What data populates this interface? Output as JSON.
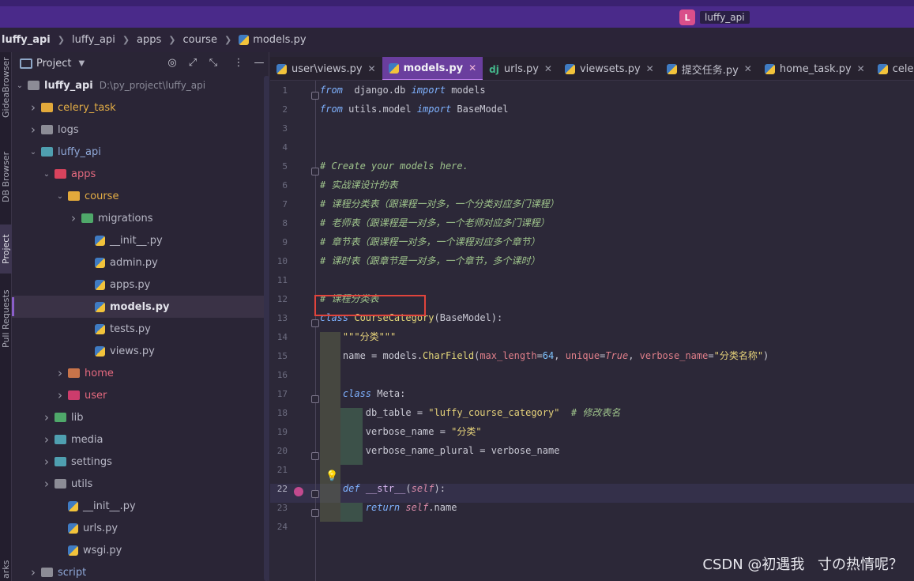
{
  "window": {
    "project_chip_letter": "L",
    "project_chip_name": "luffy_api"
  },
  "breadcrumb": [
    "luffy_api",
    "luffy_api",
    "apps",
    "course",
    "models.py"
  ],
  "toolstrip": {
    "tabs": [
      "GideaBrowser",
      "DB Browser",
      "Project",
      "Pull Requests",
      "arks"
    ]
  },
  "project_panel": {
    "title": "Project",
    "tree": [
      {
        "label": "luffy_api",
        "path": "D:\\py_project\\luffy_api",
        "indent": 0,
        "arrow": "down",
        "icon": "grey",
        "style": "bold"
      },
      {
        "label": "celery_task",
        "indent": 1,
        "arrow": "right",
        "icon": "yellow",
        "style": "yellow"
      },
      {
        "label": "logs",
        "indent": 1,
        "arrow": "right",
        "icon": "grey",
        "style": ""
      },
      {
        "label": "luffy_api",
        "indent": 1,
        "arrow": "down",
        "icon": "teal",
        "style": "blue"
      },
      {
        "label": "apps",
        "indent": 2,
        "arrow": "down",
        "icon": "red",
        "style": "red"
      },
      {
        "label": "course",
        "indent": 3,
        "arrow": "down",
        "icon": "yellow",
        "style": "yellow"
      },
      {
        "label": "migrations",
        "indent": 4,
        "arrow": "right",
        "icon": "green",
        "style": ""
      },
      {
        "label": "__init__.py",
        "indent": 5,
        "arrow": "",
        "icon": "py",
        "style": ""
      },
      {
        "label": "admin.py",
        "indent": 5,
        "arrow": "",
        "icon": "py",
        "style": ""
      },
      {
        "label": "apps.py",
        "indent": 5,
        "arrow": "",
        "icon": "py",
        "style": ""
      },
      {
        "label": "models.py",
        "indent": 5,
        "arrow": "",
        "icon": "py",
        "style": "bold",
        "selected": true
      },
      {
        "label": "tests.py",
        "indent": 5,
        "arrow": "",
        "icon": "py",
        "style": ""
      },
      {
        "label": "views.py",
        "indent": 5,
        "arrow": "",
        "icon": "py",
        "style": ""
      },
      {
        "label": "home",
        "indent": 3,
        "arrow": "right",
        "icon": "orange",
        "style": "red"
      },
      {
        "label": "user",
        "indent": 3,
        "arrow": "right",
        "icon": "pink",
        "style": "red"
      },
      {
        "label": "lib",
        "indent": 2,
        "arrow": "right",
        "icon": "green",
        "style": ""
      },
      {
        "label": "media",
        "indent": 2,
        "arrow": "right",
        "icon": "teal",
        "style": ""
      },
      {
        "label": "settings",
        "indent": 2,
        "arrow": "right",
        "icon": "teal",
        "style": ""
      },
      {
        "label": "utils",
        "indent": 2,
        "arrow": "right",
        "icon": "grey",
        "style": ""
      },
      {
        "label": "__init__.py",
        "indent": 3,
        "arrow": "",
        "icon": "py",
        "style": ""
      },
      {
        "label": "urls.py",
        "indent": 3,
        "arrow": "",
        "icon": "py",
        "style": ""
      },
      {
        "label": "wsgi.py",
        "indent": 3,
        "arrow": "",
        "icon": "py",
        "style": ""
      },
      {
        "label": "script",
        "indent": 1,
        "arrow": "right",
        "icon": "grey",
        "style": "blue"
      }
    ]
  },
  "tabs": [
    {
      "label": "user\\views.py",
      "icon": "py",
      "active": false
    },
    {
      "label": "models.py",
      "icon": "py",
      "active": true
    },
    {
      "label": "urls.py",
      "icon": "dj",
      "active": false
    },
    {
      "label": "viewsets.py",
      "icon": "py",
      "active": false
    },
    {
      "label": "提交任务.py",
      "icon": "py",
      "active": false
    },
    {
      "label": "home_task.py",
      "icon": "py",
      "active": false
    },
    {
      "label": "celery.py",
      "icon": "py",
      "active": false
    }
  ],
  "tab_dj_icon": "dj",
  "editor": {
    "line_numbers": [
      "1",
      "2",
      "3",
      "4",
      "5",
      "6",
      "7",
      "8",
      "9",
      "10",
      "11",
      "12",
      "13",
      "14",
      "15",
      "16",
      "17",
      "18",
      "19",
      "20",
      "21",
      "22",
      "23",
      "24"
    ],
    "current_line": "22",
    "lines": [
      {
        "n": 1,
        "tokens": [
          [
            "kw",
            "from"
          ],
          [
            "",
            "  django.db "
          ],
          [
            "kw",
            "import"
          ],
          [
            "",
            " models"
          ]
        ]
      },
      {
        "n": 2,
        "tokens": [
          [
            "kw",
            "from"
          ],
          [
            "",
            " utils.model "
          ],
          [
            "kw",
            "import"
          ],
          [
            "",
            " BaseModel"
          ]
        ]
      },
      {
        "n": 3,
        "tokens": []
      },
      {
        "n": 4,
        "tokens": []
      },
      {
        "n": 5,
        "tokens": [
          [
            "cmt",
            "# Create your models here."
          ]
        ]
      },
      {
        "n": 6,
        "tokens": [
          [
            "cmt",
            "# 实战课设计的表"
          ]
        ]
      },
      {
        "n": 7,
        "tokens": [
          [
            "cmt",
            "# 课程分类表（跟课程一对多，一个分类对应多门课程）"
          ]
        ]
      },
      {
        "n": 8,
        "tokens": [
          [
            "cmt",
            "# 老师表（跟课程是一对多，一个老师对应多门课程）"
          ]
        ]
      },
      {
        "n": 9,
        "tokens": [
          [
            "cmt",
            "# 章节表（跟课程一对多，一个课程对应多个章节）"
          ]
        ]
      },
      {
        "n": 10,
        "tokens": [
          [
            "cmt",
            "# 课时表（跟章节是一对多，一个章节，多个课时）"
          ]
        ]
      },
      {
        "n": 11,
        "tokens": []
      },
      {
        "n": 12,
        "tokens": [
          [
            "cmt",
            "# 课程分类表"
          ]
        ]
      },
      {
        "n": 13,
        "tokens": [
          [
            "kw",
            "class"
          ],
          [
            "",
            " "
          ],
          [
            "cls",
            "CourseCategory"
          ],
          [
            "",
            "(BaseModel):"
          ]
        ]
      },
      {
        "n": 14,
        "tokens": [
          [
            "",
            "    "
          ],
          [
            "str",
            "\"\"\"分类\"\"\""
          ]
        ]
      },
      {
        "n": 15,
        "tokens": [
          [
            "",
            "    name = models."
          ],
          [
            "cls",
            "CharField"
          ],
          [
            "",
            "("
          ],
          [
            "kwarg",
            "max_length"
          ],
          [
            "",
            "="
          ],
          [
            "num",
            "64"
          ],
          [
            "",
            ", "
          ],
          [
            "kwarg",
            "unique"
          ],
          [
            "",
            "="
          ],
          [
            "bool",
            "True"
          ],
          [
            "",
            ", "
          ],
          [
            "kwarg",
            "verbose_name"
          ],
          [
            "",
            "="
          ],
          [
            "str",
            "\"分类名称\""
          ],
          [
            "",
            ")"
          ]
        ]
      },
      {
        "n": 16,
        "tokens": []
      },
      {
        "n": 17,
        "tokens": [
          [
            "",
            "    "
          ],
          [
            "kw",
            "class"
          ],
          [
            "",
            " Meta:"
          ]
        ]
      },
      {
        "n": 18,
        "tokens": [
          [
            "",
            "        db_table = "
          ],
          [
            "str",
            "\"luffy_course_category\""
          ],
          [
            "",
            "  "
          ],
          [
            "cmt",
            "# 修改表名"
          ]
        ]
      },
      {
        "n": 19,
        "tokens": [
          [
            "",
            "        verbose_name = "
          ],
          [
            "str",
            "\"分类\""
          ]
        ]
      },
      {
        "n": 20,
        "tokens": [
          [
            "",
            "        verbose_name_plural = verbose_name"
          ]
        ]
      },
      {
        "n": 21,
        "tokens": []
      },
      {
        "n": 22,
        "tokens": [
          [
            "",
            "    "
          ],
          [
            "kw",
            "def"
          ],
          [
            "",
            " "
          ],
          [
            "fn",
            "__str__"
          ],
          [
            "",
            "("
          ],
          [
            "self",
            "self"
          ],
          [
            "",
            "):"
          ]
        ]
      },
      {
        "n": 23,
        "tokens": [
          [
            "",
            "        "
          ],
          [
            "kw",
            "return"
          ],
          [
            "",
            " "
          ],
          [
            "self",
            "self"
          ],
          [
            "",
            ".name"
          ]
        ]
      },
      {
        "n": 24,
        "tokens": []
      }
    ]
  },
  "watermark": "CSDN @初遇我ㅤ寸の热情呢？",
  "colors": {
    "title_bar": "#4a2a8a",
    "active_tab": "#6a3e9e",
    "highlight_box": "#e0443c",
    "selection_accent": "#8a5ec9"
  }
}
